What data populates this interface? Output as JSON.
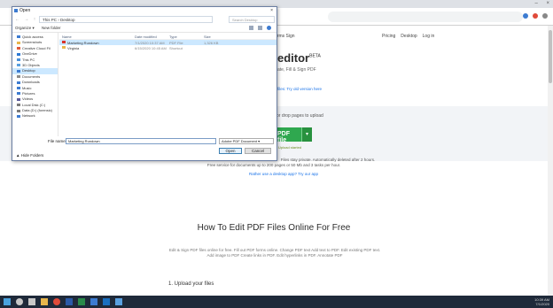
{
  "browser": {
    "window_controls": [
      "–",
      "×"
    ],
    "accent": "#1a73e8"
  },
  "site": {
    "nav_left": "Forms  Sign",
    "nav_right": [
      "Pricing",
      "Desktop",
      "Log in"
    ],
    "hero_title": "editor",
    "hero_sup": "BETA",
    "hero_subtitle": "ate, Fill & Sign PDF",
    "hero_link": "files: Try old version here",
    "upload_title": "or drop pages to upload",
    "upload_button": "PDF file",
    "upload_dropdown": "▾",
    "upload_note": "Upload started",
    "info_line1": "Files stay private. Automatically deleted after 2 hours.",
    "info_line2": "Free service for documents up to 200 pages or 50 Mb and 3 tasks per hour.",
    "info_link": "Rather use a desktop app? Try our app",
    "section_title": "How To Edit PDF Files Online For Free",
    "section_text": "Edit & Sign PDF files online for free. Fill out PDF forms online. Change PDF text Add text to PDF. Edit existing PDF text. Add image to PDF Create links in PDF. Edit hyperlinks in PDF. Annotate PDF",
    "upload_files": "1.  Upload your files"
  },
  "dialog": {
    "title": "Open",
    "close": "×",
    "nav_buttons": "← → ↑",
    "path": "This PC  ›  Desktop",
    "search_placeholder": "Search Desktop",
    "organize": "Organize ▾",
    "new_folder": "New folder",
    "nav_items": [
      {
        "label": "Quick access",
        "icon": "star-icon",
        "color": "#3c7bd1"
      },
      {
        "label": "Screenshots",
        "icon": "folder-icon",
        "color": "#e8b64c"
      },
      {
        "label": "Creative Cloud Fil",
        "icon": "cloud-icon",
        "color": "#e05a3a"
      },
      {
        "label": "OneDrive",
        "icon": "cloud-icon",
        "color": "#2b78d4"
      },
      {
        "label": "This PC",
        "icon": "computer-icon",
        "color": "#4a90d9"
      },
      {
        "label": "3D Objects",
        "icon": "cube-icon",
        "color": "#5aa0e0"
      },
      {
        "label": "Desktop",
        "icon": "desktop-icon",
        "color": "#3c7bd1"
      },
      {
        "label": "Documents",
        "icon": "document-icon",
        "color": "#8a8a8a"
      },
      {
        "label": "Downloads",
        "icon": "download-icon",
        "color": "#3c7bd1"
      },
      {
        "label": "Music",
        "icon": "music-icon",
        "color": "#3c7bd1"
      },
      {
        "label": "Pictures",
        "icon": "picture-icon",
        "color": "#3c7bd1"
      },
      {
        "label": "Videos",
        "icon": "video-icon",
        "color": "#5a5a9a"
      },
      {
        "label": "Local Disk (C:)",
        "icon": "drive-icon",
        "color": "#7a7a7a"
      },
      {
        "label": "Data (D:) (forensic)",
        "icon": "drive-icon",
        "color": "#7a7a7a"
      },
      {
        "label": "Network",
        "icon": "network-icon",
        "color": "#3c7bd1"
      }
    ],
    "columns": [
      "Name",
      "Date modified",
      "Type",
      "Size"
    ],
    "files": [
      {
        "name": "Marketing Rundown",
        "date": "7/1/2020 10:37 AM",
        "type": "PDF File",
        "size": "1,326 KB",
        "icon_color": "#d9342b",
        "selected": true
      },
      {
        "name": "Virginia",
        "date": "6/15/2020 10:45 AM",
        "type": "Shortcut",
        "size": "",
        "icon_color": "#e8b64c",
        "selected": false
      }
    ],
    "filename_label": "File name:",
    "filename_value": "Marketing Rundown",
    "filetype": "Adobe PDF Document  ▾",
    "hide_folders": "▲ Hide Folders",
    "open_button": "Open",
    "cancel_button": "Cancel"
  },
  "taskbar": {
    "icons": [
      {
        "name": "windows-icon",
        "color": "#4aa3df"
      },
      {
        "name": "search-icon",
        "color": "#c8c8c8"
      },
      {
        "name": "task-view-icon",
        "color": "#c8c8c8"
      },
      {
        "name": "explorer-icon",
        "color": "#e8b64c"
      },
      {
        "name": "chrome-icon",
        "color": "#e04a3a"
      },
      {
        "name": "word-icon",
        "color": "#2b5aa8"
      },
      {
        "name": "excel-icon",
        "color": "#2a8a4a"
      },
      {
        "name": "mail-icon",
        "color": "#3c7bd1"
      },
      {
        "name": "outlook-icon",
        "color": "#1a6fc0"
      },
      {
        "name": "photos-icon",
        "color": "#5aa0e0"
      }
    ],
    "time": "10:39 AM",
    "date": "7/1/2020"
  }
}
